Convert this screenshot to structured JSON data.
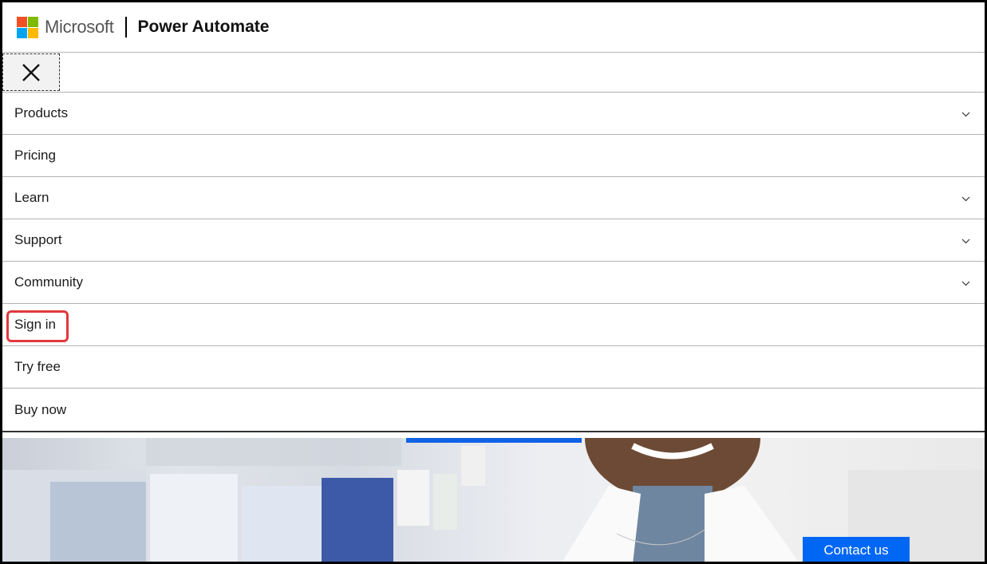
{
  "header": {
    "brand_name": "Microsoft",
    "product_name": "Power Automate",
    "logo_colors": [
      "#f25022",
      "#7fba00",
      "#00a4ef",
      "#ffb900"
    ]
  },
  "close_button": {
    "icon": "close-icon"
  },
  "nav": {
    "items": [
      {
        "label": "Products",
        "has_chevron": true
      },
      {
        "label": "Pricing",
        "has_chevron": false
      },
      {
        "label": "Learn",
        "has_chevron": true
      },
      {
        "label": "Support",
        "has_chevron": true
      },
      {
        "label": "Community",
        "has_chevron": true
      },
      {
        "label": "Sign in",
        "has_chevron": false,
        "highlighted": true
      },
      {
        "label": "Try free",
        "has_chevron": false
      },
      {
        "label": "Buy now",
        "has_chevron": false
      }
    ]
  },
  "hero": {
    "contact_label": "Contact us",
    "accent_color": "#0067f5"
  }
}
